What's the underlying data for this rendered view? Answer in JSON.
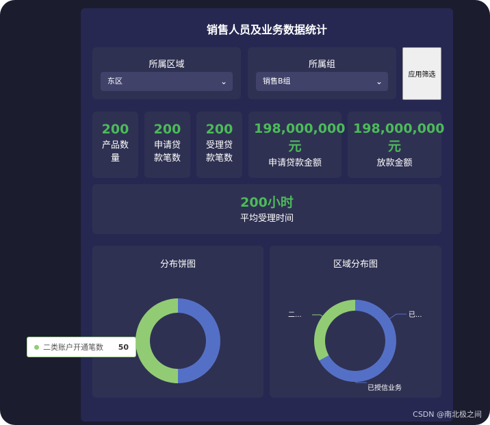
{
  "page": {
    "title": "销售人员及业务数据统计"
  },
  "filters": {
    "region": {
      "label": "所属区域",
      "value": "东区"
    },
    "group": {
      "label": "所属组",
      "value": "销售B组"
    },
    "apply_label": "应用筛选"
  },
  "stats": [
    {
      "value": "200",
      "label": "产品数量"
    },
    {
      "value": "200",
      "label": "申请贷款笔数"
    },
    {
      "value": "200",
      "label": "受理贷款笔数"
    },
    {
      "value": "198,000,000元",
      "label": "申请贷款金额"
    },
    {
      "value": "198,000,000元",
      "label": "放款金额"
    }
  ],
  "avg": {
    "value": "200小时",
    "label": "平均受理时间"
  },
  "charts": {
    "pie_title": "分布饼图",
    "region_title": "区域分布图",
    "region_label_left": "二...",
    "region_label_right": "已...",
    "region_label_bottom": "已授信业务"
  },
  "tooltip": {
    "name": "二类账户开通笔数",
    "value": "50"
  },
  "watermark": "CSDN @南北极之间",
  "colors": {
    "blue": "#5470c6",
    "green": "#91cc75",
    "accent_green": "#4cbb5a"
  },
  "chart_data": [
    {
      "type": "pie",
      "title": "分布饼图",
      "series": [
        {
          "name": "",
          "value": 50
        },
        {
          "name": "二类账户开通笔数",
          "value": 50
        }
      ]
    },
    {
      "type": "pie",
      "title": "区域分布图",
      "series": [
        {
          "name": "已...",
          "value": 34
        },
        {
          "name": "已授信业务",
          "value": 33
        },
        {
          "name": "二...",
          "value": 33
        }
      ]
    }
  ]
}
